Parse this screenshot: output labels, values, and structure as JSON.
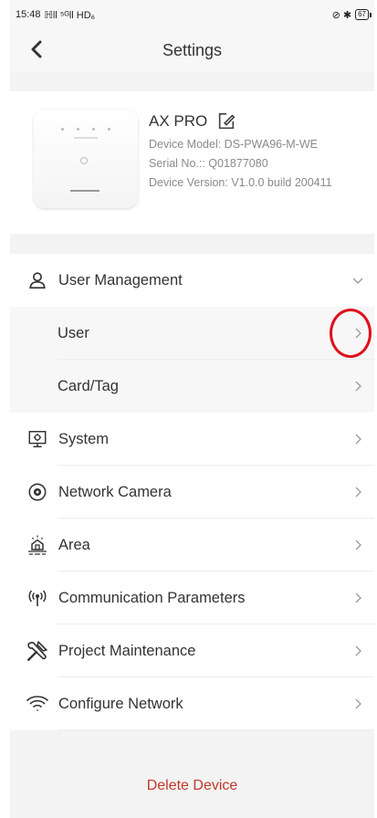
{
  "status_bar": {
    "time": "15:48",
    "signal_text": "ℍll ⁵ᴳll HD₆",
    "right_icons": "⊘ ✱",
    "battery": "67"
  },
  "header": {
    "title": "Settings"
  },
  "device": {
    "name": "AX PRO",
    "model": "Device Model: DS-PWA96-M-WE",
    "serial": "Serial No.:: Q01877080",
    "version": "Device Version: V1.0.0 build 200411"
  },
  "menu": {
    "user_management": "User Management",
    "user": "User",
    "card_tag": "Card/Tag",
    "system": "System",
    "network_camera": "Network Camera",
    "area": "Area",
    "communication": "Communication Parameters",
    "project_maintenance": "Project Maintenance",
    "configure_network": "Configure Network"
  },
  "actions": {
    "delete_device": "Delete Device"
  },
  "colors": {
    "accent_red": "#c0392b",
    "annotation_red": "#e0101b"
  }
}
